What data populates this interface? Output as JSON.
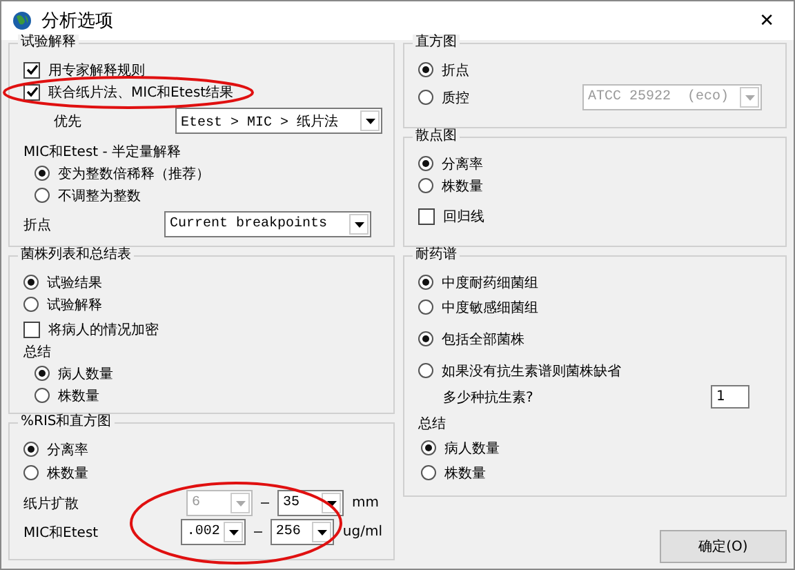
{
  "window": {
    "title": "分析选项",
    "close": "✕"
  },
  "interpretation": {
    "title": "试验解释",
    "checks": [
      {
        "label": "用专家解释规则",
        "checked": true
      },
      {
        "label": "联合纸片法、MIC和Etest结果",
        "checked": true
      }
    ],
    "priority": {
      "label": "优先",
      "value": "Etest > MIC > 纸片法"
    },
    "mic_title": "MIC和Etest - 半定量解释",
    "mic_options": [
      {
        "label": "变为整数倍稀释（推荐）",
        "selected": true
      },
      {
        "label": "不调整为整数",
        "selected": false
      }
    ],
    "breakpoint": {
      "label": "折点",
      "value": "Current breakpoints"
    }
  },
  "strain_list": {
    "title": "菌株列表和总结表",
    "options": [
      {
        "label": "试验结果",
        "selected": true
      },
      {
        "label": "试验解释",
        "selected": false
      }
    ],
    "encrypt": {
      "label": "将病人的情况加密",
      "checked": false
    },
    "summary_title": "总结",
    "summary_options": [
      {
        "label": "病人数量",
        "selected": true
      },
      {
        "label": "株数量",
        "selected": false
      }
    ]
  },
  "ris": {
    "title": "%RIS和直方图",
    "options": [
      {
        "label": "分离率",
        "selected": true
      },
      {
        "label": "株数量",
        "selected": false
      }
    ],
    "ranges": [
      {
        "label": "纸片扩散",
        "from": {
          "value": "6",
          "disabled": true
        },
        "to": {
          "value": "35",
          "disabled": false
        },
        "unit": "mm"
      },
      {
        "label": "MIC和Etest",
        "from": {
          "value": ".002",
          "disabled": false
        },
        "to": {
          "value": "256",
          "disabled": false
        },
        "unit": "ug/ml"
      }
    ]
  },
  "histogram": {
    "title": "直方图",
    "options": [
      {
        "label": "折点",
        "selected": true
      },
      {
        "label": "质控",
        "selected": false
      }
    ],
    "qc": {
      "value": "ATCC 25922  (eco)",
      "disabled": true
    }
  },
  "scatter": {
    "title": "散点图",
    "options": [
      {
        "label": "分离率",
        "selected": true
      },
      {
        "label": "株数量",
        "selected": false
      }
    ],
    "regression": {
      "label": "回归线",
      "checked": false
    }
  },
  "resistance": {
    "title": "耐药谱",
    "options": [
      {
        "label": "中度耐药细菌组",
        "selected": true
      },
      {
        "label": "中度敏感细菌组",
        "selected": false
      }
    ],
    "scope": [
      {
        "label": "包括全部菌株",
        "selected": true
      },
      {
        "label": "如果没有抗生素谱则菌株缺省",
        "selected": false
      }
    ],
    "count": {
      "label": "多少种抗生素?",
      "value": "1"
    },
    "summary_title": "总结",
    "summary_options": [
      {
        "label": "病人数量",
        "selected": true
      },
      {
        "label": "株数量",
        "selected": false
      }
    ]
  },
  "ok_button": {
    "label": "确定(O)"
  }
}
